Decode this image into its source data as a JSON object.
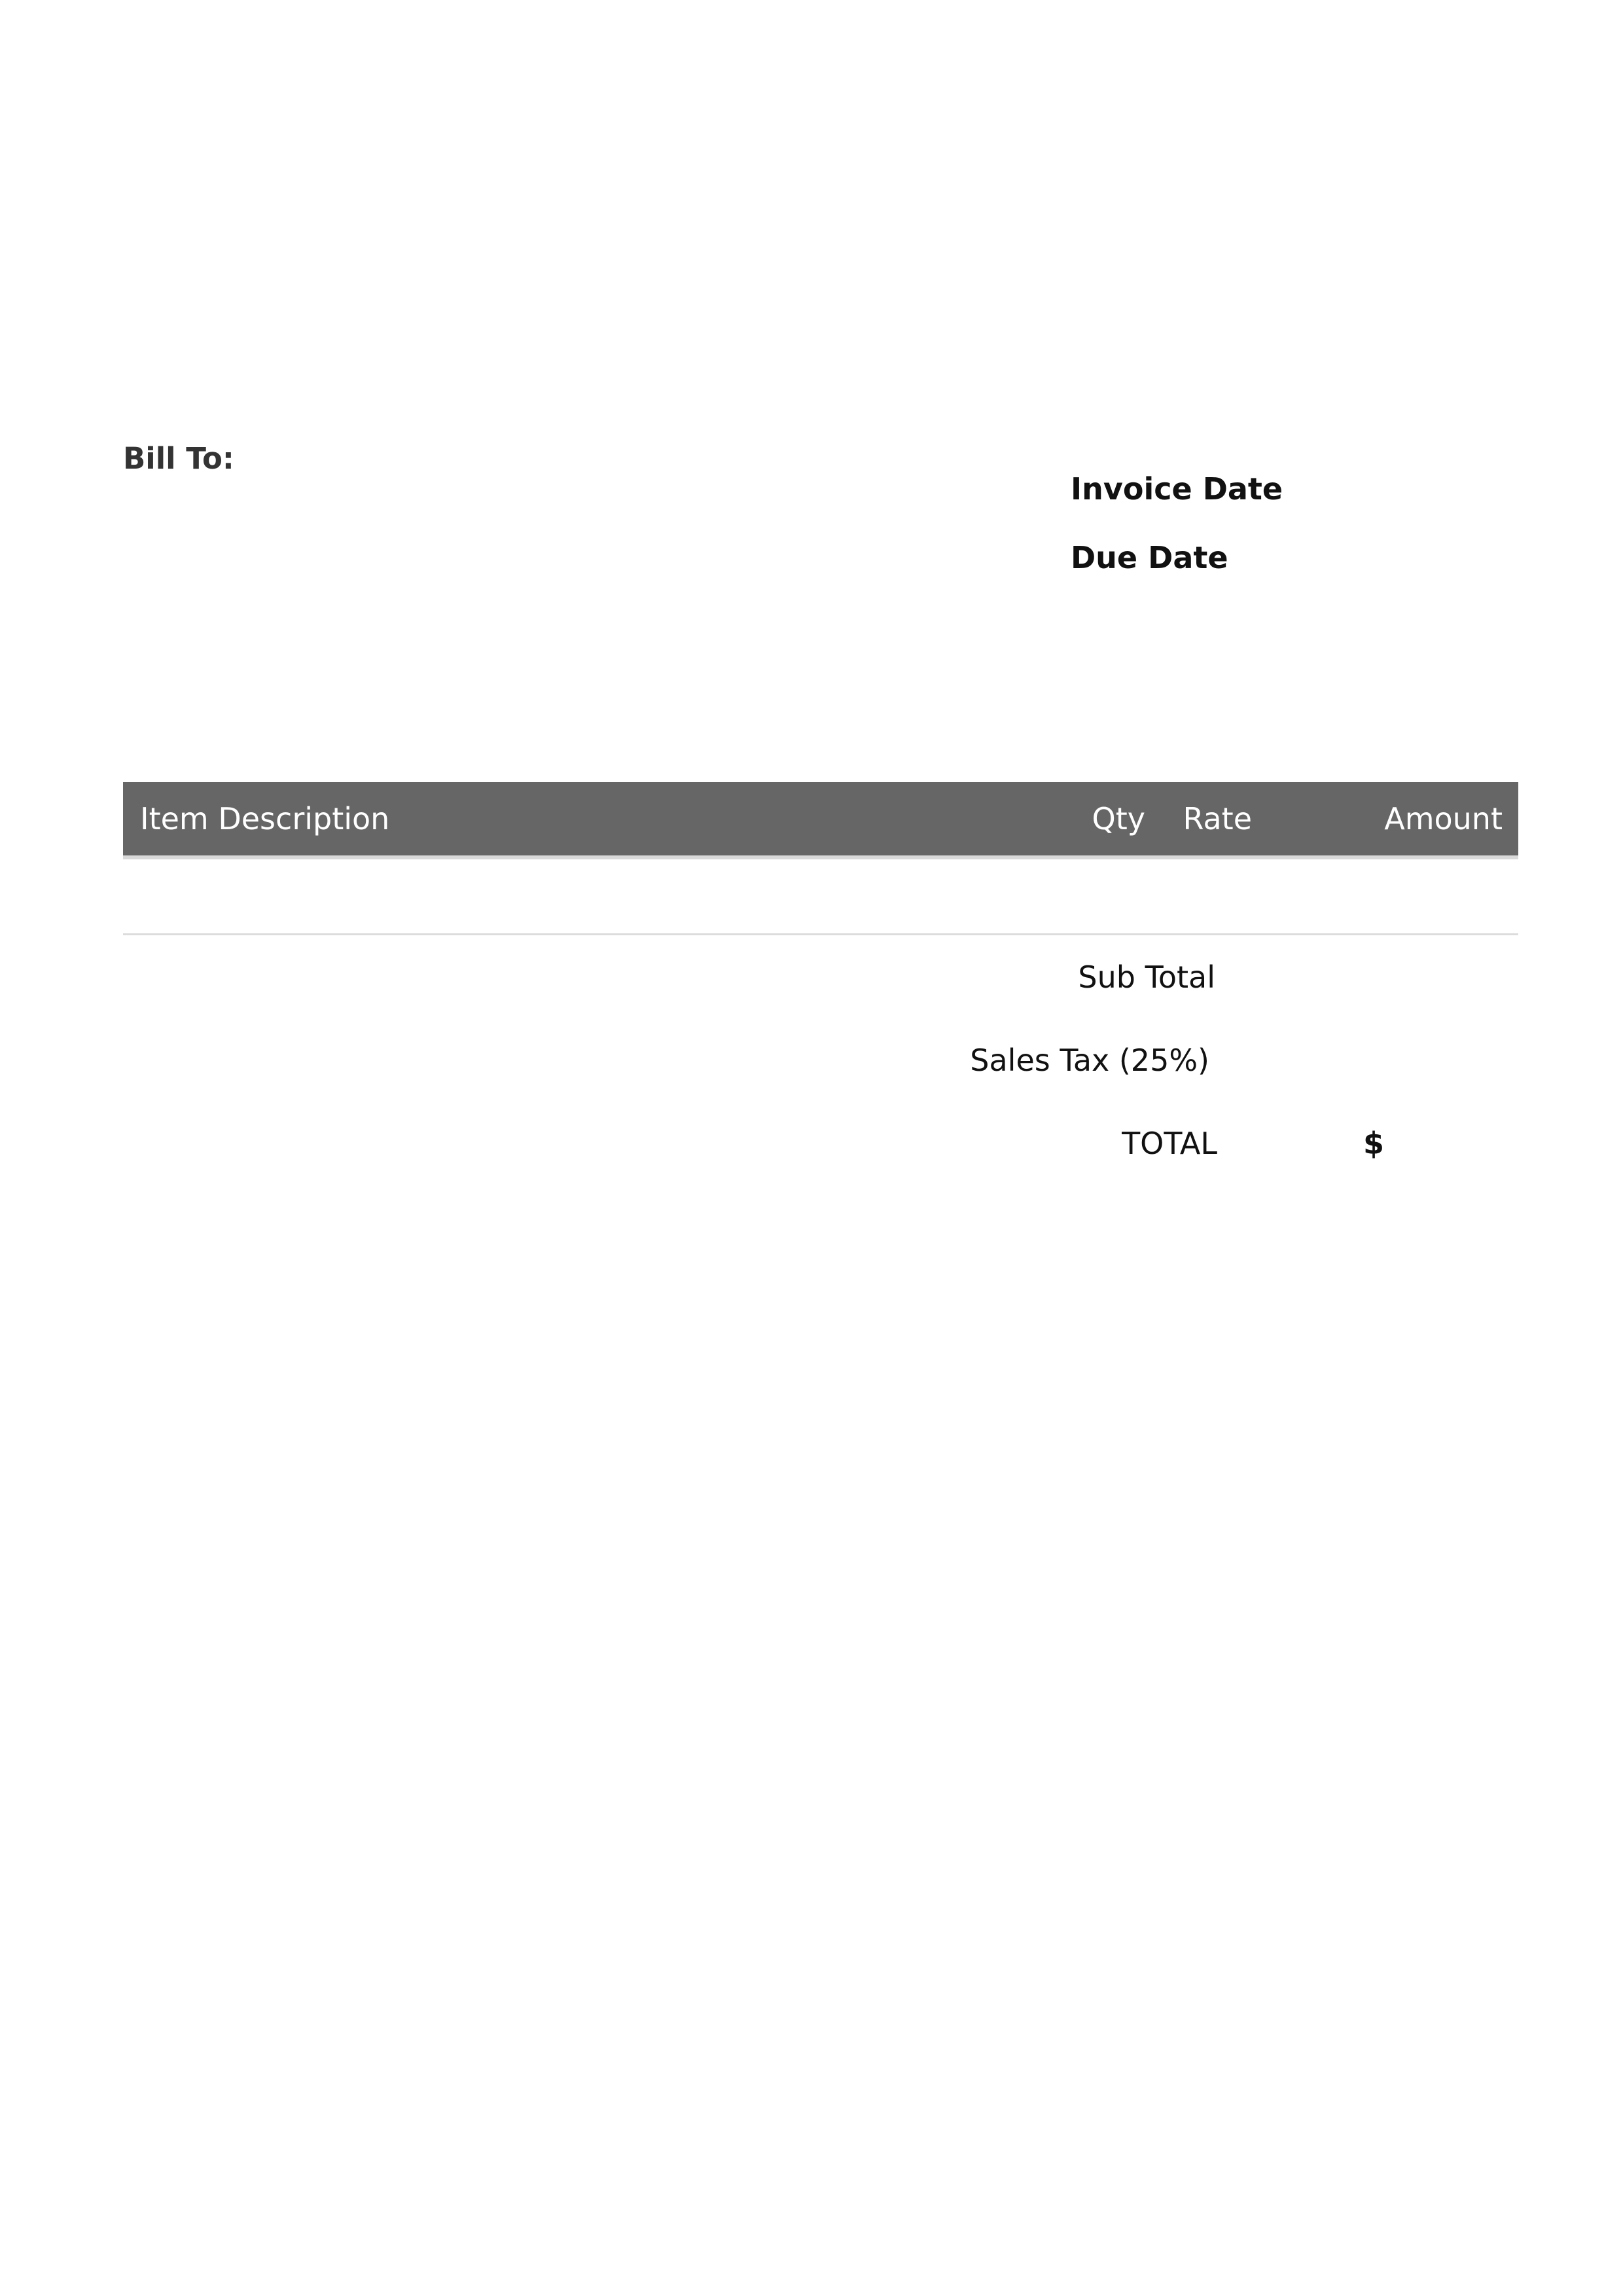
{
  "billing": {
    "bill_to_label": "Bill To:"
  },
  "dates": {
    "invoice_date_label": "Invoice Date",
    "due_date_label": "Due Date"
  },
  "items_table": {
    "columns": {
      "description": "Item Description",
      "qty": "Qty",
      "rate": "Rate",
      "amount": "Amount"
    },
    "header_color": "#666666",
    "rows": []
  },
  "totals": {
    "subtotal_label": "Sub Total",
    "sales_tax_label": "Sales Tax (25%)",
    "total_label": "TOTAL",
    "total_currency": "$"
  }
}
